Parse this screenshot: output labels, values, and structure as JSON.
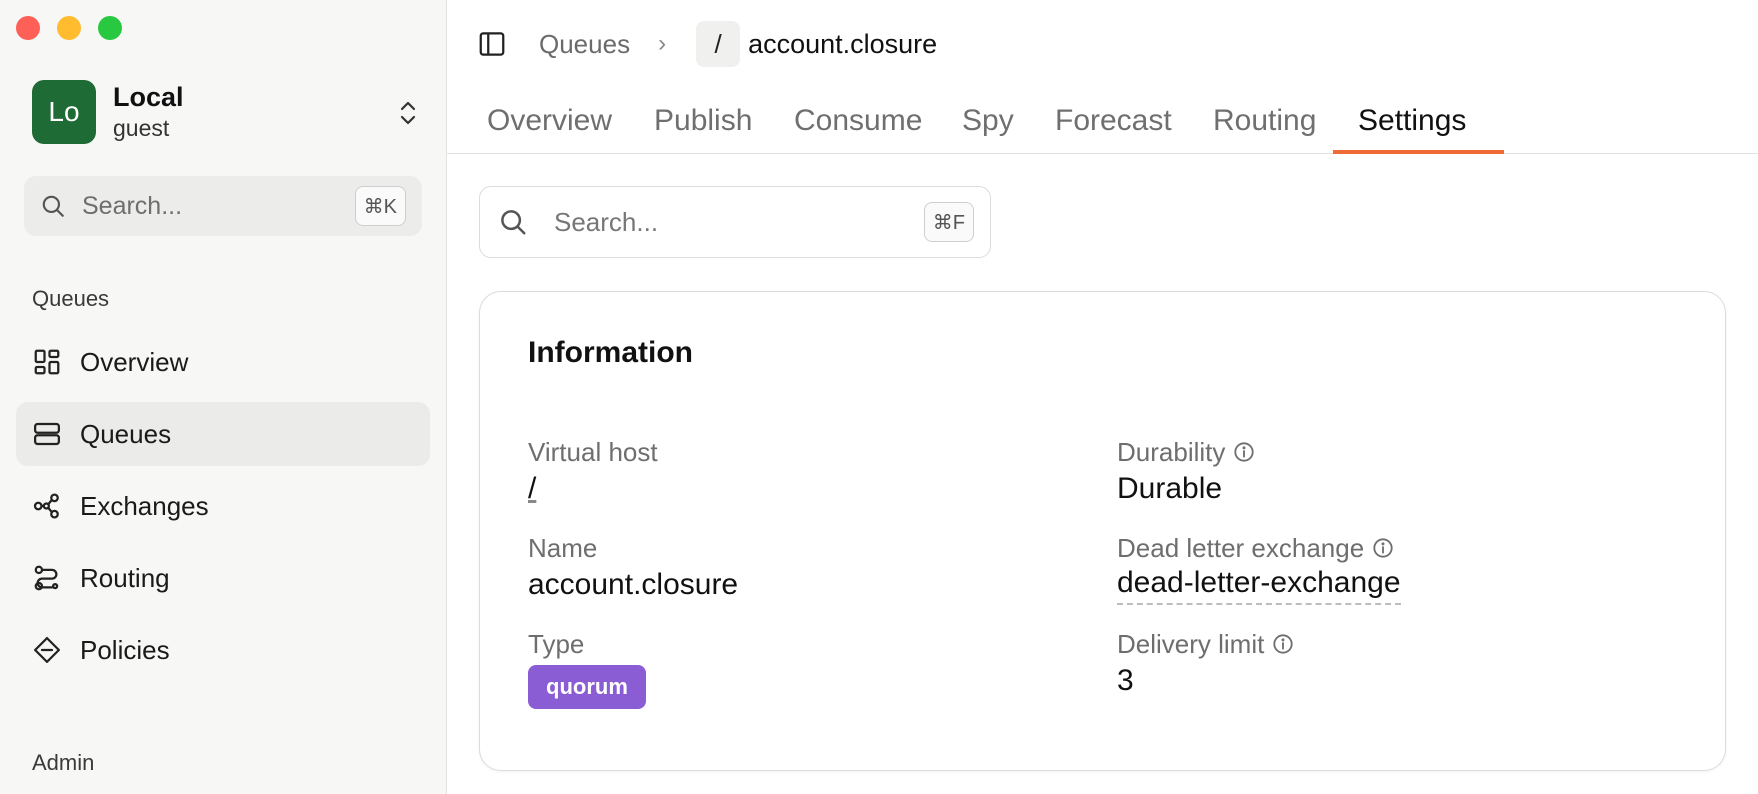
{
  "window": {
    "traffic_lights": {
      "close_color": "#fe5f57",
      "minimize_color": "#febc2e",
      "zoom_color": "#28c840"
    }
  },
  "sidebar": {
    "account": {
      "initials": "Lo",
      "name": "Local",
      "user": "guest",
      "avatar_color": "#1f6b35"
    },
    "search": {
      "placeholder": "Search...",
      "shortcut": "⌘K"
    },
    "sections": [
      {
        "label": "Queues",
        "items": [
          {
            "label": "Overview",
            "icon": "dashboard-icon",
            "active": false
          },
          {
            "label": "Queues",
            "icon": "queues-icon",
            "active": true
          },
          {
            "label": "Exchanges",
            "icon": "exchanges-icon",
            "active": false
          },
          {
            "label": "Routing",
            "icon": "routing-icon",
            "active": false
          },
          {
            "label": "Policies",
            "icon": "policies-icon",
            "active": false
          }
        ]
      },
      {
        "label": "Admin",
        "items": []
      }
    ]
  },
  "header": {
    "breadcrumb": {
      "parent": "Queues",
      "vhost": "/",
      "current": "account.closure"
    }
  },
  "tabs": [
    {
      "label": "Overview",
      "active": false
    },
    {
      "label": "Publish",
      "active": false
    },
    {
      "label": "Consume",
      "active": false
    },
    {
      "label": "Spy",
      "active": false
    },
    {
      "label": "Forecast",
      "active": false
    },
    {
      "label": "Routing",
      "active": false
    },
    {
      "label": "Settings",
      "active": true
    }
  ],
  "accent_color": "#f06a35",
  "main_search": {
    "placeholder": "Search...",
    "shortcut": "⌘F"
  },
  "information": {
    "title": "Information",
    "virtual_host": {
      "label": "Virtual host",
      "value": "/"
    },
    "name": {
      "label": "Name",
      "value": "account.closure"
    },
    "type": {
      "label": "Type",
      "value": "quorum",
      "badge_color": "#8a5dd4"
    },
    "durability": {
      "label": "Durability",
      "value": "Durable"
    },
    "dead_letter_exchange": {
      "label": "Dead letter exchange",
      "value": "dead-letter-exchange"
    },
    "delivery_limit": {
      "label": "Delivery limit",
      "value": "3"
    }
  }
}
